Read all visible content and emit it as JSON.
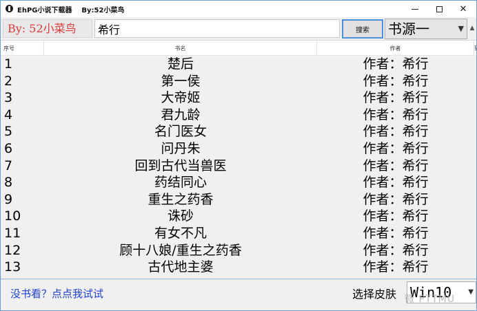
{
  "window": {
    "title": "EhPG小说下载器    By:52小菜鸟",
    "minimize_icon": "minimize-icon",
    "maximize_icon": "maximize-icon",
    "close_icon": "close-icon"
  },
  "toolbar": {
    "by_label": "By: 52小菜鸟",
    "search_value": "希行",
    "search_button": "搜索",
    "source_selected": "书源一",
    "scroll_up": "▲"
  },
  "list": {
    "headers": {
      "seq": "序号",
      "name": "书名",
      "author": "作者",
      "extra": "到"
    },
    "rows": [
      {
        "num": "1",
        "name": "楚后",
        "author": "作者：希行"
      },
      {
        "num": "2",
        "name": "第一侯",
        "author": "作者：希行"
      },
      {
        "num": "3",
        "name": "大帝姬",
        "author": "作者：希行"
      },
      {
        "num": "4",
        "name": "君九龄",
        "author": "作者：希行"
      },
      {
        "num": "5",
        "name": "名门医女",
        "author": "作者：希行"
      },
      {
        "num": "6",
        "name": "问丹朱",
        "author": "作者：希行"
      },
      {
        "num": "7",
        "name": "回到古代当兽医",
        "author": "作者：希行"
      },
      {
        "num": "8",
        "name": "药结同心",
        "author": "作者：希行"
      },
      {
        "num": "9",
        "name": "重生之药香",
        "author": "作者：希行"
      },
      {
        "num": "10",
        "name": "诛砂",
        "author": "作者：希行"
      },
      {
        "num": "11",
        "name": "有女不凡",
        "author": "作者：希行"
      },
      {
        "num": "12",
        "name": "顾十八娘/重生之药香",
        "author": "作者：希行"
      },
      {
        "num": "13",
        "name": "古代地主婆",
        "author": "作者：希行"
      }
    ]
  },
  "footer": {
    "try_link": "没书看？点点我试试",
    "skin_label": "选择皮肤",
    "skin_selected": "Win10",
    "watermark": "微 PTTMU"
  },
  "colors": {
    "by_label_text": "#e03a3a",
    "link_text": "#1f3fd0",
    "search_button_border": "#4a90d9",
    "window_border": "#6e9fd6"
  }
}
